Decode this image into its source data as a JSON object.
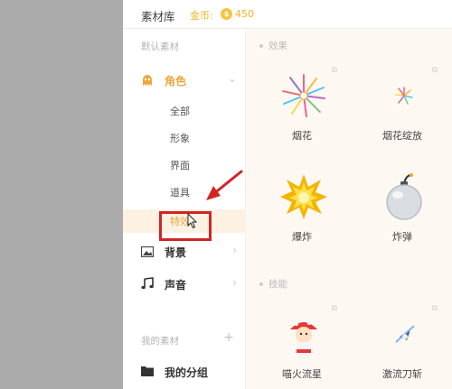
{
  "header": {
    "title": "素材库",
    "coins_label": "金币:",
    "coin_glyph": "$",
    "coins_value": "450"
  },
  "sidebar": {
    "default_section": "默认素材",
    "categories": [
      {
        "label": "角色",
        "icon": "ghost-icon"
      },
      {
        "label": "背景",
        "icon": "image-icon"
      },
      {
        "label": "声音",
        "icon": "music-note-icon"
      }
    ],
    "subitems": [
      "全部",
      "形象",
      "界面",
      "道具",
      "特效"
    ],
    "selected_subitem": "特效",
    "my_section": "我的素材",
    "my_groups": {
      "label": "我的分组",
      "icon": "folder-icon"
    }
  },
  "content": {
    "groups": [
      {
        "title": "效果",
        "items": [
          "烟花",
          "烟花绽放",
          "爆炸",
          "炸弹"
        ]
      },
      {
        "title": "技能",
        "items": [
          "喵火流星",
          "激流刀斩"
        ]
      }
    ]
  },
  "colors": {
    "accent": "#f0a43c",
    "highlight_box": "#d32424",
    "coin": "#f5c542"
  }
}
